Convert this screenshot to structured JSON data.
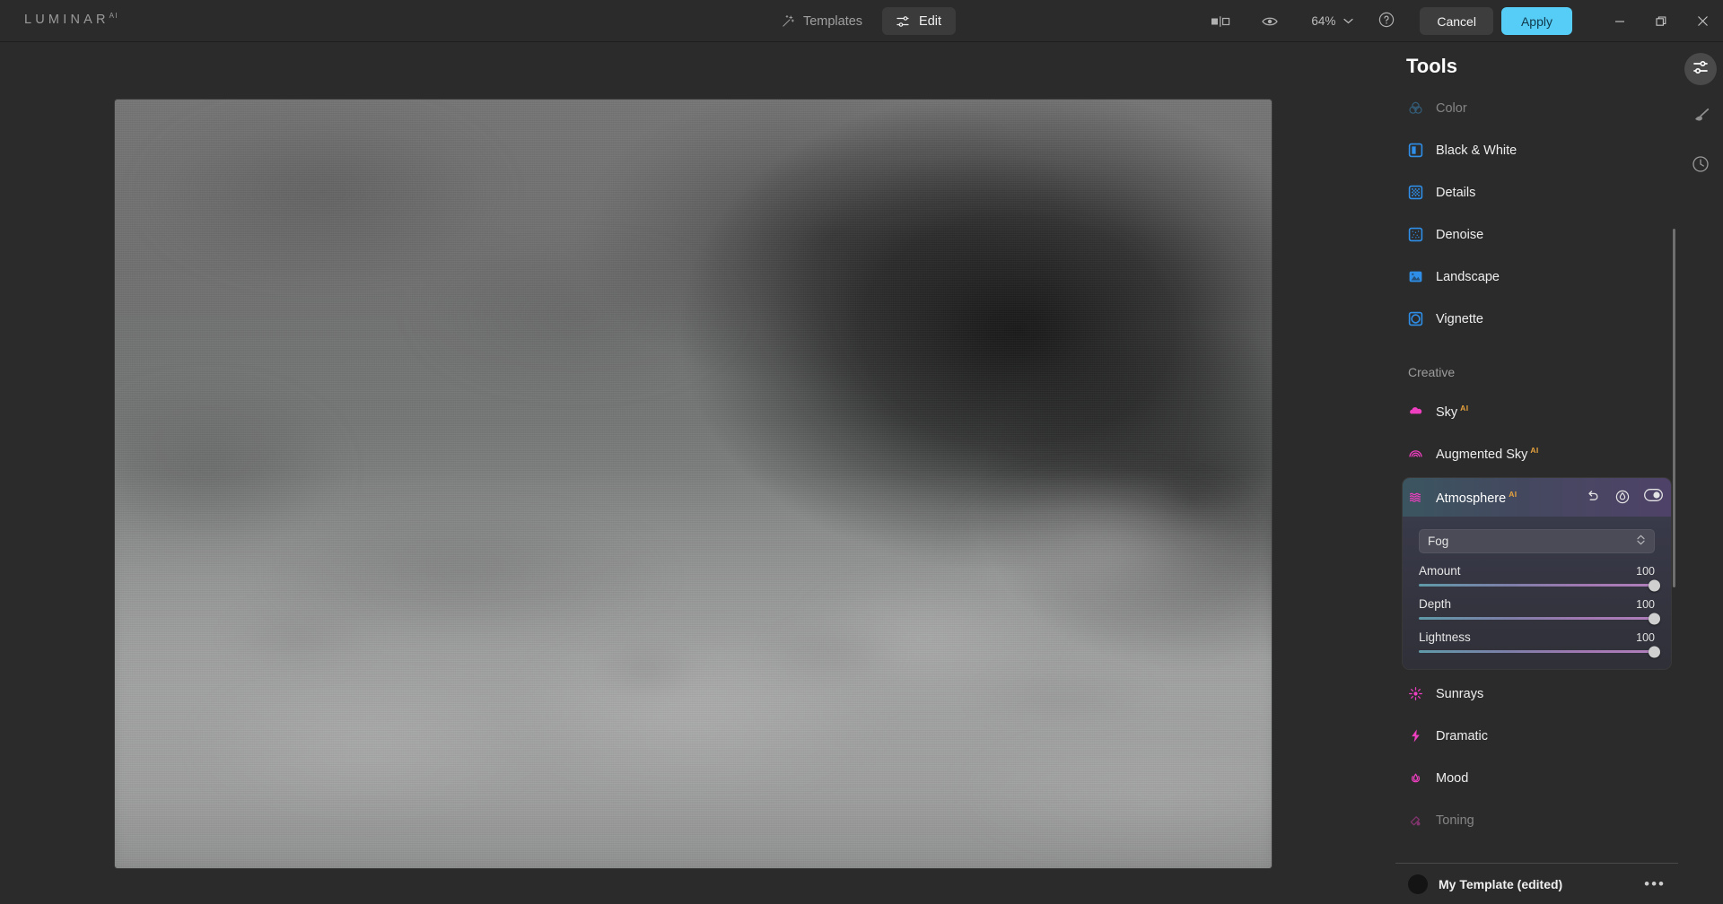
{
  "app": {
    "brand": "LUMINAR",
    "brand_sup": "AI"
  },
  "topbar": {
    "templates_label": "Templates",
    "edit_label": "Edit",
    "compare_icon": "compare-split-icon",
    "preview_icon": "eye-icon",
    "zoom_level": "64%",
    "zoom_chevron_icon": "chevron-down-icon",
    "help_icon": "question-circle-icon",
    "cancel_label": "Cancel",
    "apply_label": "Apply",
    "minimize_icon": "minimize-icon",
    "maximize_icon": "maximize-icon",
    "close_icon": "close-icon",
    "accent_blue": "#56cdf7",
    "tab_underline": "#2f9fe0"
  },
  "panel": {
    "title": "Tools",
    "tools": [
      {
        "label": "Color",
        "icon": "color-circles-icon",
        "faded": true,
        "ai": false
      },
      {
        "label": "Black & White",
        "icon": "black-white-icon",
        "faded": false,
        "ai": false
      },
      {
        "label": "Details",
        "icon": "details-grid-icon",
        "faded": false,
        "ai": false
      },
      {
        "label": "Denoise",
        "icon": "denoise-icon",
        "faded": false,
        "ai": false
      },
      {
        "label": "Landscape",
        "icon": "landscape-image-icon",
        "faded": false,
        "ai": false
      },
      {
        "label": "Vignette",
        "icon": "vignette-icon",
        "faded": false,
        "ai": false
      }
    ],
    "creative_group_label": "Creative",
    "creative_before": [
      {
        "label": "Sky",
        "icon": "cloud-icon",
        "ai": "AI"
      },
      {
        "label": "Augmented Sky",
        "icon": "rainbow-icon",
        "ai": "AI"
      }
    ],
    "creative_after": [
      {
        "label": "Sunrays",
        "icon": "sun-icon",
        "ai": ""
      },
      {
        "label": "Dramatic",
        "icon": "lightning-bolt-icon",
        "ai": ""
      },
      {
        "label": "Mood",
        "icon": "lotus-icon",
        "ai": ""
      },
      {
        "label": "Toning",
        "icon": "toning-icon",
        "ai": ""
      }
    ],
    "atmosphere": {
      "label": "Atmosphere",
      "ai": "AI",
      "icon": "waves-icon",
      "reset_icon": "undo-arrow-icon",
      "mask_icon": "masking-brush-icon",
      "toggle_icon": "toggle-switch-on-icon",
      "select_value": "Fog",
      "select_chevron_icon": "updown-chevron-icon",
      "sliders": [
        {
          "label": "Amount",
          "value": "100",
          "percent": 100
        },
        {
          "label": "Depth",
          "value": "100",
          "percent": 100
        },
        {
          "label": "Lightness",
          "value": "100",
          "percent": 100
        }
      ]
    },
    "template_bar": {
      "name": "My Template (edited)",
      "more_icon": "ellipsis-icon",
      "more_label": "•••"
    }
  },
  "rail": {
    "items": [
      {
        "icon": "sliders-adjust-icon",
        "active": true
      },
      {
        "icon": "brush-icon",
        "active": false
      },
      {
        "icon": "history-clock-icon",
        "active": false
      }
    ]
  }
}
